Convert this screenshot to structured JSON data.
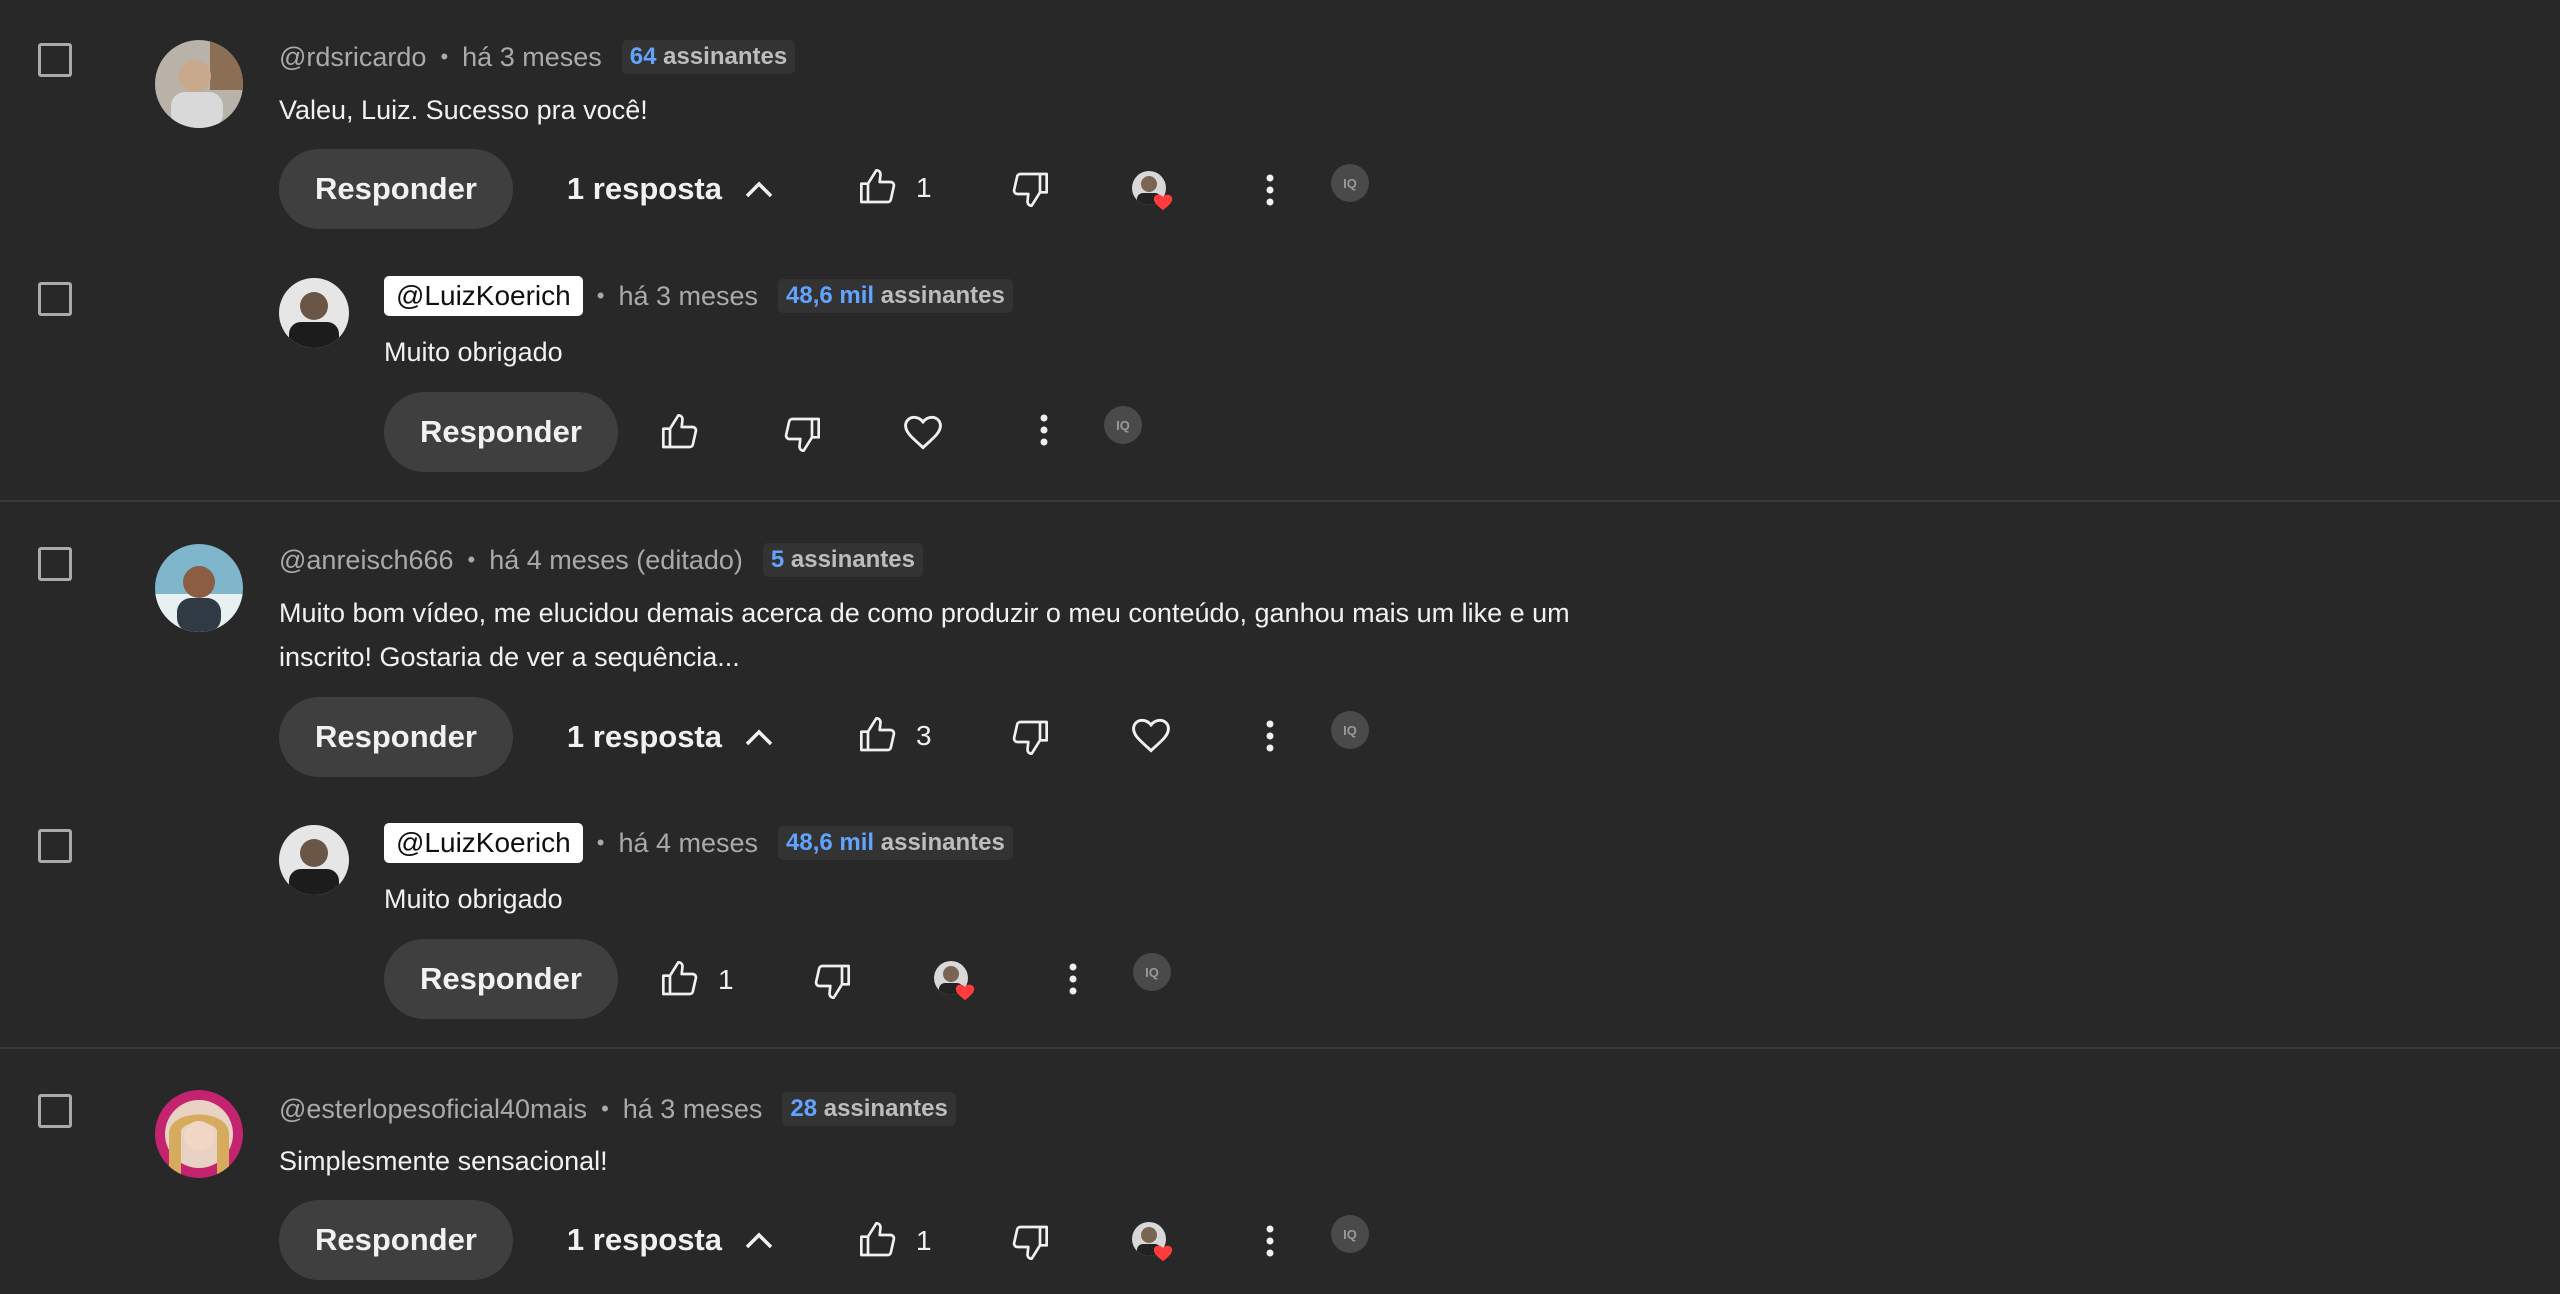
{
  "colors": {
    "background": "#282828",
    "accent_subs": "#62a3ff",
    "heart": "#ff3b3b"
  },
  "ext_badge_label": "IQ",
  "threads": [
    {
      "author": "@rdsricardo",
      "time": "há 3 meses",
      "subs_num": "64",
      "subs_label": "assinantes",
      "text": "Valeu, Luiz. Sucesso pra você!",
      "reply_label": "Responder",
      "replies_label": "1 resposta",
      "likes": "1",
      "hearted": true,
      "reply": {
        "author": "@LuizKoerich",
        "time": "há 3 meses",
        "subs_num": "48,6 mil",
        "subs_label": "assinantes",
        "text": "Muito obrigado",
        "reply_label": "Responder",
        "likes": "",
        "hearted": false
      }
    },
    {
      "author": "@anreisch666",
      "time": "há 4 meses (editado)",
      "subs_num": "5",
      "subs_label": "assinantes",
      "text_lines": [
        "Muito bom vídeo, me elucidou demais acerca de como produzir o meu conteúdo, ganhou mais um like e um",
        "inscrito! Gostaria de ver a sequência..."
      ],
      "reply_label": "Responder",
      "replies_label": "1 resposta",
      "likes": "3",
      "hearted": false,
      "reply": {
        "author": "@LuizKoerich",
        "time": "há 4 meses",
        "subs_num": "48,6 mil",
        "subs_label": "assinantes",
        "text": "Muito obrigado",
        "reply_label": "Responder",
        "likes": "1",
        "hearted": true
      }
    },
    {
      "author": "@esterlopesoficial40mais",
      "time": "há 3 meses",
      "subs_num": "28",
      "subs_label": "assinantes",
      "text": "Simplesmente sensacional!",
      "reply_label": "Responder",
      "replies_label": "1 resposta",
      "likes": "1",
      "hearted": true
    }
  ]
}
